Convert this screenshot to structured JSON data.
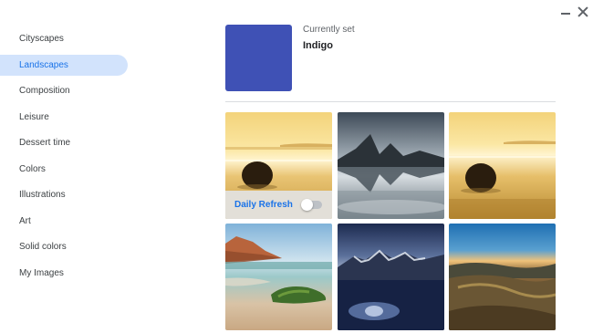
{
  "window": {
    "minimize_icon": "minimize-icon",
    "close_icon": "close-icon"
  },
  "sidebar": {
    "items": [
      {
        "label": "Cityscapes",
        "active": false
      },
      {
        "label": "Landscapes",
        "active": true
      },
      {
        "label": "Composition",
        "active": false
      },
      {
        "label": "Leisure",
        "active": false
      },
      {
        "label": "Dessert time",
        "active": false
      },
      {
        "label": "Colors",
        "active": false
      },
      {
        "label": "Illustrations",
        "active": false
      },
      {
        "label": "Art",
        "active": false
      },
      {
        "label": "Solid colors",
        "active": false
      },
      {
        "label": "My Images",
        "active": false
      }
    ]
  },
  "current": {
    "label": "Currently set",
    "name": "Indigo",
    "color": "#3f51b5"
  },
  "gallery": {
    "tiles": [
      {
        "subject": "golden beach with dark round rock"
      },
      {
        "subject": "mountain fjord with reflection"
      },
      {
        "subject": "golden beach with dark round rock"
      },
      {
        "subject": "coastal cliffs with mossy rock"
      },
      {
        "subject": "snowy mountains over dark lake"
      },
      {
        "subject": "sunset hills and valley"
      }
    ],
    "daily_refresh_label": "Daily Refresh",
    "daily_refresh_enabled": false
  },
  "colors": {
    "accent": "#1a73e8",
    "active_bg": "#d2e3fc"
  }
}
